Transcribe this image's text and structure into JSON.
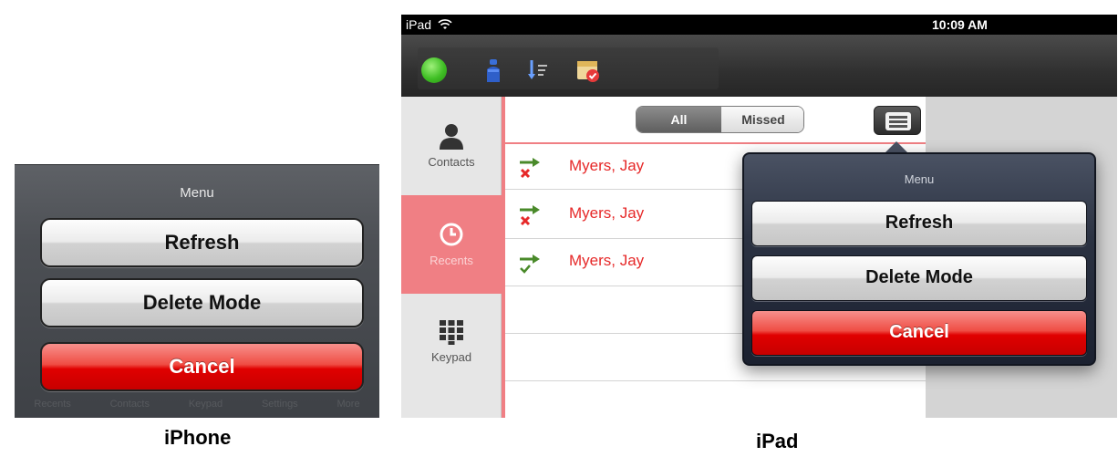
{
  "iphone": {
    "menu_title": "Menu",
    "buttons": {
      "refresh": "Refresh",
      "delete_mode": "Delete Mode",
      "cancel": "Cancel"
    },
    "tabbar": [
      "Recents",
      "Contacts",
      "Keypad",
      "Settings",
      "More"
    ]
  },
  "ipad": {
    "status": {
      "device": "iPad",
      "time": "10:09 AM"
    },
    "toolbar_icons": [
      "status-green-icon",
      "person-icon",
      "sort-icon",
      "calendar-check-icon"
    ],
    "tabs": [
      {
        "label": "Contacts",
        "icon": "person-icon"
      },
      {
        "label": "Recents",
        "icon": "clock-icon"
      },
      {
        "label": "Keypad",
        "icon": "keypad-icon"
      }
    ],
    "segment": {
      "all": "All",
      "missed": "Missed"
    },
    "calls": [
      {
        "name": "Myers, Jay",
        "type": "missed"
      },
      {
        "name": "Myers, Jay",
        "type": "missed"
      },
      {
        "name": "Myers, Jay",
        "type": "answered"
      }
    ],
    "popover": {
      "menu_title": "Menu",
      "buttons": {
        "refresh": "Refresh",
        "delete_mode": "Delete Mode",
        "cancel": "Cancel"
      }
    }
  },
  "captions": {
    "iphone": "iPhone",
    "ipad": "iPad"
  },
  "colors": {
    "accent_red": "#e62929",
    "recents_pink": "#f07f84",
    "cancel_red": "#e00000"
  }
}
